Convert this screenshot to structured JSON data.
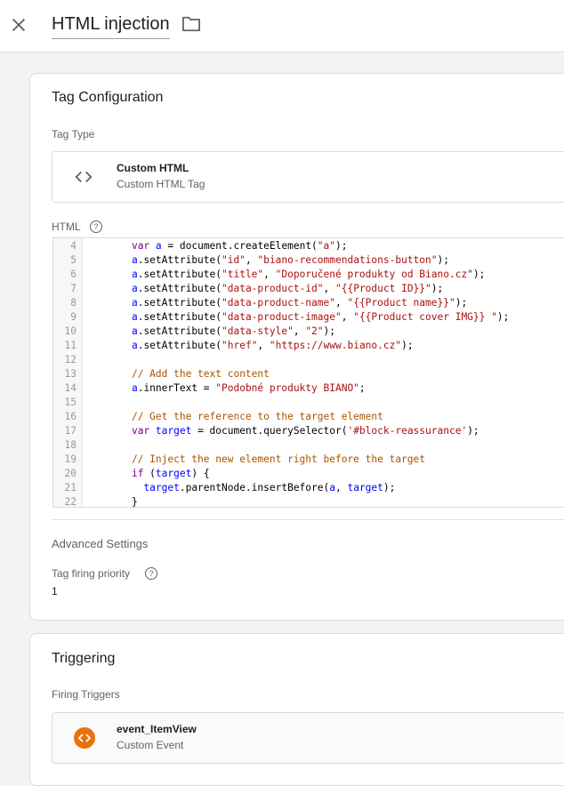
{
  "header": {
    "title": "HTML injection",
    "close_icon": "close-icon",
    "folder_icon": "folder-icon"
  },
  "tag_config": {
    "title": "Tag Configuration",
    "tag_type_label": "Tag Type",
    "tag_type": {
      "name": "Custom HTML",
      "description": "Custom HTML Tag",
      "icon": "code-brackets-icon"
    },
    "html_label": "HTML",
    "html_help_icon": "help-icon",
    "code_lines": [
      {
        "n": "4",
        "segs": [
          [
            "",
            "    "
          ],
          [
            "kw",
            "var"
          ],
          [
            "",
            " "
          ],
          [
            "var",
            "a"
          ],
          [
            "",
            " = document.createElement("
          ],
          [
            "str",
            "\"a\""
          ],
          [
            "",
            ");"
          ]
        ]
      },
      {
        "n": "5",
        "segs": [
          [
            "",
            "    "
          ],
          [
            "var",
            "a"
          ],
          [
            "",
            ".setAttribute("
          ],
          [
            "str",
            "\"id\""
          ],
          [
            "",
            ", "
          ],
          [
            "str",
            "\"biano-recommendations-button\""
          ],
          [
            "",
            ");"
          ]
        ]
      },
      {
        "n": "6",
        "segs": [
          [
            "",
            "    "
          ],
          [
            "var",
            "a"
          ],
          [
            "",
            ".setAttribute("
          ],
          [
            "str",
            "\"title\""
          ],
          [
            "",
            ", "
          ],
          [
            "str",
            "\"Doporučené produkty od Biano.cz\""
          ],
          [
            "",
            ");"
          ]
        ]
      },
      {
        "n": "7",
        "segs": [
          [
            "",
            "    "
          ],
          [
            "var",
            "a"
          ],
          [
            "",
            ".setAttribute("
          ],
          [
            "str",
            "\"data-product-id\""
          ],
          [
            "",
            ", "
          ],
          [
            "str",
            "\"{{Product ID}}\""
          ],
          [
            "",
            ");"
          ]
        ]
      },
      {
        "n": "8",
        "segs": [
          [
            "",
            "    "
          ],
          [
            "var",
            "a"
          ],
          [
            "",
            ".setAttribute("
          ],
          [
            "str",
            "\"data-product-name\""
          ],
          [
            "",
            ", "
          ],
          [
            "str",
            "\"{{Product name}}\""
          ],
          [
            "",
            ");"
          ]
        ]
      },
      {
        "n": "9",
        "segs": [
          [
            "",
            "    "
          ],
          [
            "var",
            "a"
          ],
          [
            "",
            ".setAttribute("
          ],
          [
            "str",
            "\"data-product-image\""
          ],
          [
            "",
            ", "
          ],
          [
            "str",
            "\"{{Product cover IMG}} \""
          ],
          [
            "",
            ");"
          ]
        ]
      },
      {
        "n": "10",
        "segs": [
          [
            "",
            "    "
          ],
          [
            "var",
            "a"
          ],
          [
            "",
            ".setAttribute("
          ],
          [
            "str",
            "\"data-style\""
          ],
          [
            "",
            ", "
          ],
          [
            "str",
            "\"2\""
          ],
          [
            "",
            ");"
          ]
        ]
      },
      {
        "n": "11",
        "segs": [
          [
            "",
            "    "
          ],
          [
            "var",
            "a"
          ],
          [
            "",
            ".setAttribute("
          ],
          [
            "str",
            "\"href\""
          ],
          [
            "",
            ", "
          ],
          [
            "str",
            "\"https://www.biano.cz\""
          ],
          [
            "",
            ");"
          ]
        ]
      },
      {
        "n": "12",
        "segs": [
          [
            "",
            ""
          ]
        ]
      },
      {
        "n": "13",
        "segs": [
          [
            "",
            "    "
          ],
          [
            "cm",
            "// Add the text content"
          ]
        ]
      },
      {
        "n": "14",
        "segs": [
          [
            "",
            "    "
          ],
          [
            "var",
            "a"
          ],
          [
            "",
            ".innerText = "
          ],
          [
            "str",
            "\"Podobné produkty BIANO\""
          ],
          [
            "",
            ";"
          ]
        ]
      },
      {
        "n": "15",
        "segs": [
          [
            "",
            ""
          ]
        ]
      },
      {
        "n": "16",
        "segs": [
          [
            "",
            "    "
          ],
          [
            "cm",
            "// Get the reference to the target element"
          ]
        ]
      },
      {
        "n": "17",
        "segs": [
          [
            "",
            "    "
          ],
          [
            "kw",
            "var"
          ],
          [
            "",
            " "
          ],
          [
            "var",
            "target"
          ],
          [
            "",
            " = document.querySelector("
          ],
          [
            "str",
            "'#block-reassurance'"
          ],
          [
            "",
            ");"
          ]
        ]
      },
      {
        "n": "18",
        "segs": [
          [
            "",
            ""
          ]
        ]
      },
      {
        "n": "19",
        "segs": [
          [
            "",
            "    "
          ],
          [
            "cm",
            "// Inject the new element right before the target"
          ]
        ]
      },
      {
        "n": "20",
        "segs": [
          [
            "",
            "    "
          ],
          [
            "kw",
            "if"
          ],
          [
            "",
            " ("
          ],
          [
            "var",
            "target"
          ],
          [
            "",
            ") {"
          ]
        ]
      },
      {
        "n": "21",
        "segs": [
          [
            "",
            "      "
          ],
          [
            "var",
            "target"
          ],
          [
            "",
            ".parentNode.insertBefore("
          ],
          [
            "var",
            "a"
          ],
          [
            "",
            ", "
          ],
          [
            "var",
            "target"
          ],
          [
            "",
            ");"
          ]
        ]
      },
      {
        "n": "22",
        "segs": [
          [
            "",
            "    }"
          ]
        ]
      }
    ],
    "advanced_title": "Advanced Settings",
    "priority_label": "Tag firing priority",
    "priority_help_icon": "help-icon",
    "priority_value": "1"
  },
  "triggering": {
    "title": "Triggering",
    "firing_label": "Firing Triggers",
    "trigger": {
      "name": "event_ItemView",
      "type": "Custom Event",
      "icon": "code-brackets-icon",
      "color": "#e8710a"
    }
  }
}
